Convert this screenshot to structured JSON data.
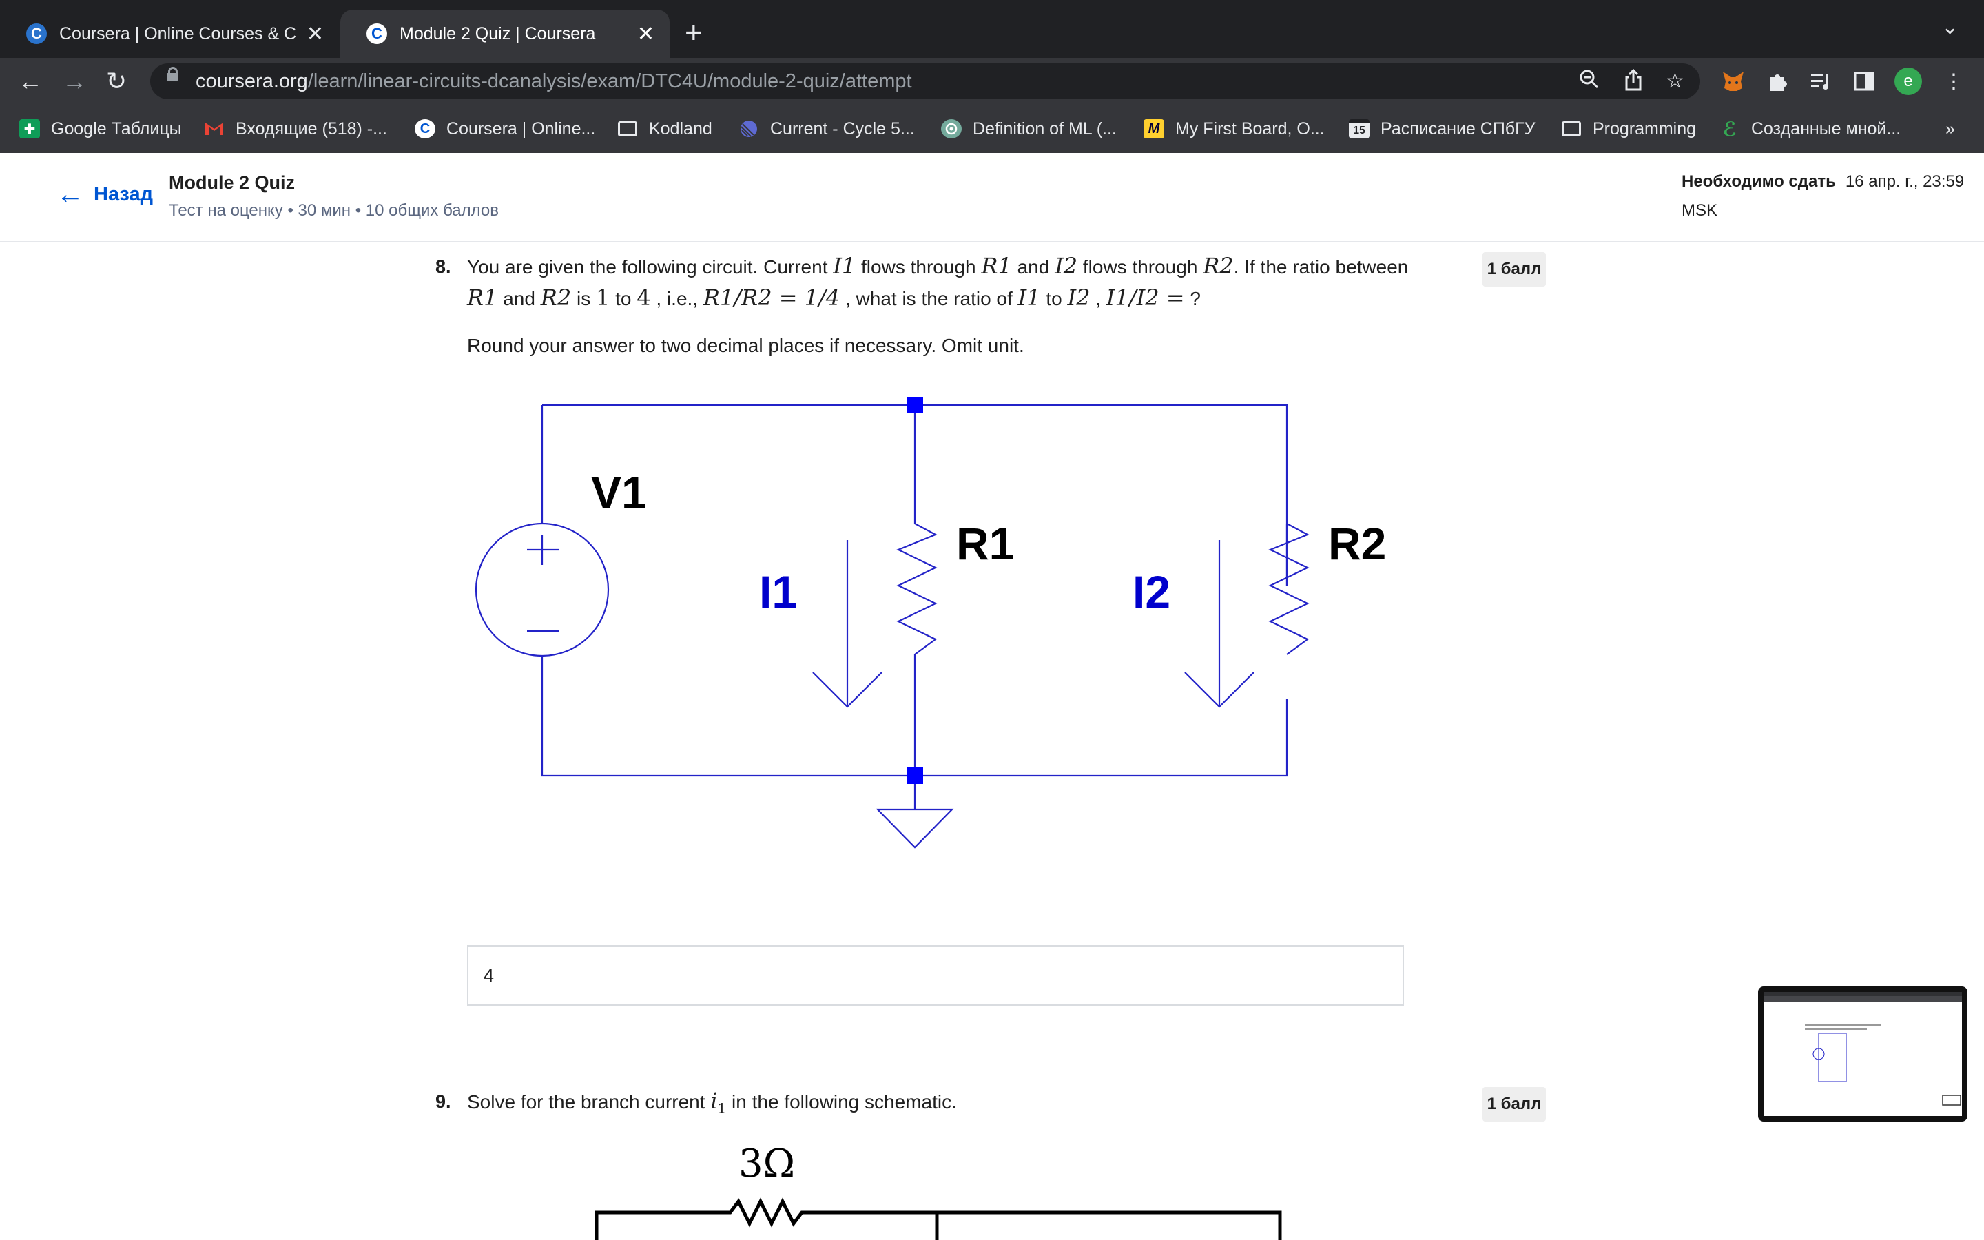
{
  "browser": {
    "tabs": [
      {
        "label": "Coursera | Online Courses & Cr",
        "favicon": "C"
      },
      {
        "label": "Module 2 Quiz | Coursera",
        "favicon": "C"
      }
    ],
    "url_domain": "coursera.org",
    "url_path": "/learn/linear-circuits-dcanalysis/exam/DTC4U/module-2-quiz/attempt",
    "profile_initial": "e",
    "bookmarks": [
      "Google Таблицы",
      "Входящие (518) -...",
      "Coursera | Online...",
      "Kodland",
      "Current - Cycle 5...",
      "Definition of ML (...",
      "My First Board, O...",
      "Расписание СПбГУ",
      "Programming",
      "Созданные мной..."
    ],
    "calendar_day": "15",
    "more_bookmarks": "»"
  },
  "header": {
    "back_label": "Назад",
    "quiz_title": "Module 2 Quiz",
    "quiz_subtitle": "Тест на оценку • 30 мин • 10 общих баллов",
    "due_label": "Необходимо сдать",
    "due_value": "16 апр. г., 23:59",
    "timezone": "MSK"
  },
  "q8": {
    "number": "8.",
    "points": "1 балл",
    "line1_a": "You are given the following circuit. Current ",
    "I1": "I1",
    "line1_b": " flows through ",
    "R1": "R1",
    "line1_c": " and ",
    "I2": "I2",
    "line1_d": " flows through ",
    "R2": "R2",
    "line1_e": ". If the ratio between",
    "line2_a": " and ",
    "line2_b": " is ",
    "one": "1",
    "line2_c": " to ",
    "four": "4",
    "line2_d": " , i.e., ",
    "eq1": "R1/R2 = 1/4",
    "line2_e": " ,  what is the ratio of ",
    "line2_f": " to ",
    "line2_g": " , ",
    "eq2": "I1/I2 =",
    "line2_h": " ?",
    "instruction": "Round your answer to two decimal places if necessary. Omit unit.",
    "answer": "4",
    "circuit": {
      "source_label": "V1",
      "r1_label": "R1",
      "r2_label": "R2",
      "i1_label": "I1",
      "i2_label": "I2",
      "wire_color": "#2323c8",
      "node_color": "#0000ff",
      "current_label_color": "#0000cc"
    }
  },
  "q9": {
    "number": "9.",
    "points": "1 балл",
    "text_a": "Solve for the branch current ",
    "var": "i",
    "sub": "1",
    "text_b": " in the following schematic.",
    "resistor_label": "3Ω"
  }
}
